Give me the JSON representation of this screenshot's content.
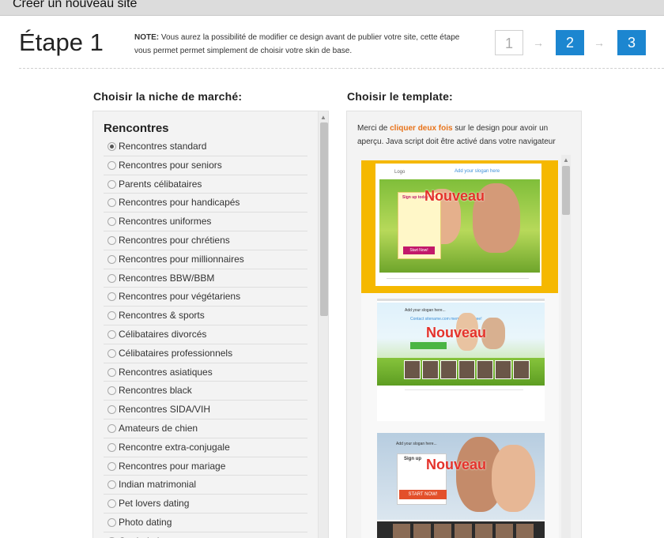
{
  "header": {
    "title": "Créer un nouveau site"
  },
  "step": {
    "title": "Étape 1",
    "note_label": "NOTE:",
    "note_text": " Vous aurez la possibilité de modifier ce design avant de publier votre site, cette étape vous permet permet simplement de choisir votre skin de base."
  },
  "steps": [
    {
      "label": "1",
      "active": false
    },
    {
      "label": "2",
      "active": true
    },
    {
      "label": "3",
      "active": true
    }
  ],
  "arrow_glyph": "→",
  "niche": {
    "heading": "Choisir la niche de marché:",
    "group_title": "Rencontres",
    "selected_index": 0,
    "items": [
      "Rencontres standard",
      "Rencontres pour seniors",
      "Parents célibataires",
      "Rencontres pour handicapés",
      "Rencontres uniformes",
      "Rencontres pour chrétiens",
      "Rencontres pour millionnaires",
      "Rencontres BBW/BBM",
      "Rencontres pour végétariens",
      "Rencontres & sports",
      "Célibataires divorcés",
      "Célibataires professionnels",
      "Rencontres asiatiques",
      "Rencontres black",
      "Rencontres SIDA/VIH",
      "Amateurs de chien",
      "Rencontre extra-conjugale",
      "Rencontres pour mariage",
      "Indian matrimonial",
      "Pet lovers dating",
      "Photo dating",
      "Geek dating"
    ]
  },
  "template": {
    "heading": "Choisir le template:",
    "intro_before": "Merci de ",
    "intro_highlight": "cliquer deux fois",
    "intro_after": " sur le design pour avoir un aperçu. Java script doit être activé dans votre navigateur",
    "badge": "Nouveau",
    "t1": {
      "logo": "Logo",
      "slogan": "Add your slogan here",
      "form_title": "Sign up today for",
      "button": "Start Now!"
    },
    "t2": {
      "slogan": "Add your slogan here...",
      "heading": "Contact sitename.com members for free!"
    },
    "t3": {
      "slogan": "Add your slogan here...",
      "form_title": "Sign up",
      "button": "START NOW!"
    }
  },
  "colors": {
    "accent": "#1c86d0",
    "highlight": "#e8731a",
    "badge": "#e4322b"
  },
  "icons": {
    "scroll_up": "triangle-up"
  }
}
